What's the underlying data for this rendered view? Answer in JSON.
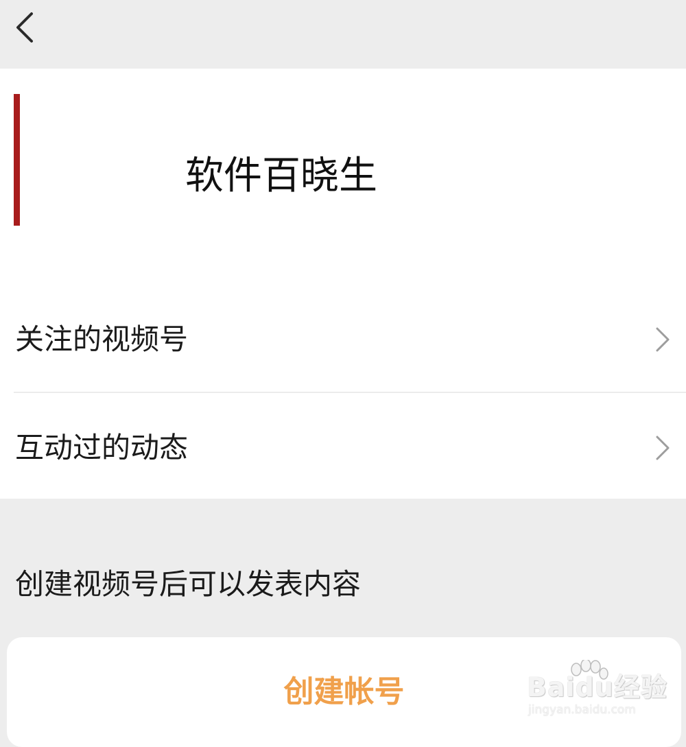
{
  "header": {
    "back_icon": "chevron-left-icon"
  },
  "profile": {
    "name": "软件百晓生",
    "accent_color": "#a81c1c"
  },
  "menu": {
    "items": [
      {
        "label": "关注的视频号",
        "icon": "chevron-right-icon"
      },
      {
        "label": "互动过的动态",
        "icon": "chevron-right-icon"
      }
    ]
  },
  "create_section": {
    "hint": "创建视频号后可以发表内容",
    "button_label": "创建帐号",
    "button_color": "#f0a04b"
  },
  "watermark": {
    "brand": "Baidu经验",
    "url": "jingyan.baidu.com"
  }
}
